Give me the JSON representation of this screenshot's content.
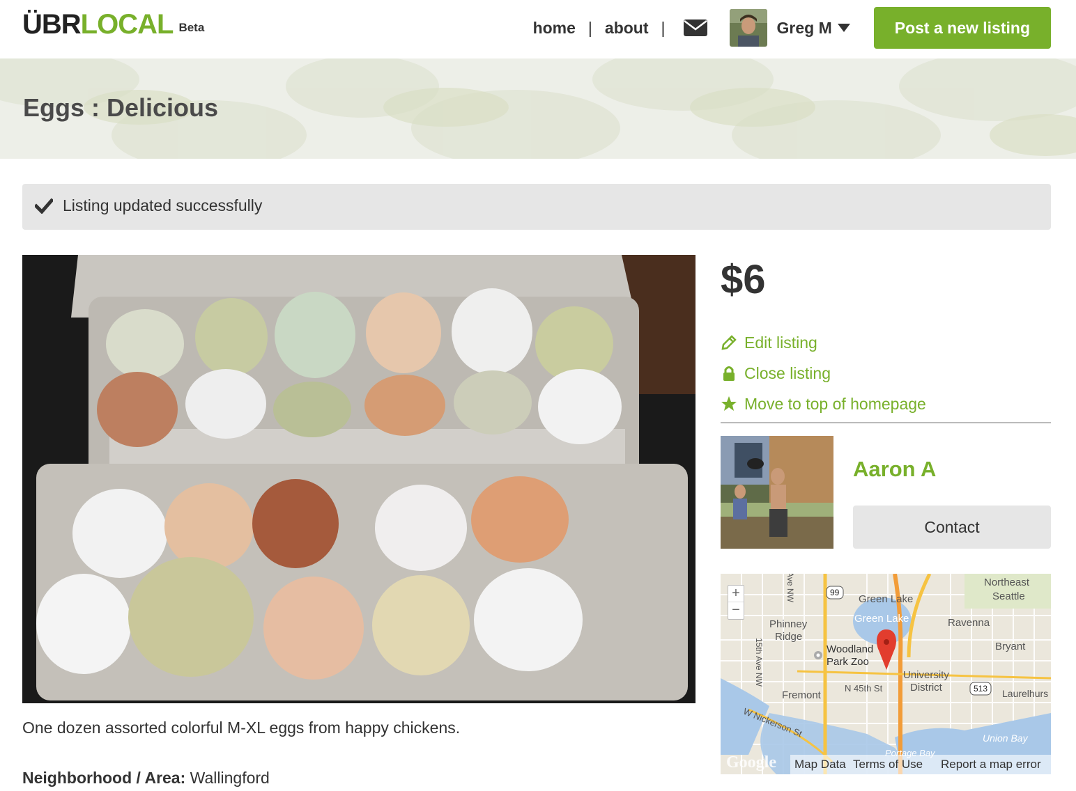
{
  "header": {
    "logo_part1": "ÜBR",
    "logo_part2": "LOCAL",
    "logo_badge": "Beta",
    "nav_home": "home",
    "nav_sep": "|",
    "nav_about": "about",
    "user_name": "Greg M",
    "post_button": "Post a new listing"
  },
  "page": {
    "title": "Eggs : Delicious"
  },
  "flash": {
    "message": "Listing updated successfully"
  },
  "listing": {
    "price": "$6",
    "description": "One dozen assorted colorful M-XL eggs from happy chickens.",
    "neighborhood_label": "Neighborhood / Area:",
    "neighborhood_value": "Wallingford"
  },
  "actions": {
    "edit": "Edit listing",
    "close": "Close listing",
    "move_top": "Move to top of homepage"
  },
  "seller": {
    "name": "Aaron A",
    "contact_button": "Contact"
  },
  "map": {
    "labels": {
      "northeast_seattle_1": "Northeast",
      "northeast_seattle_2": "Seattle",
      "green_lake_1": "Green Lake",
      "green_lake_2": "Green Lake",
      "phinney_1": "Phinney",
      "phinney_2": "Ridge",
      "ravenna": "Ravenna",
      "bryant": "Bryant",
      "woodland_1": "Woodland",
      "woodland_2": "Park Zoo",
      "university_1": "University",
      "university_2": "District",
      "n45th": "N 45th St",
      "fremont": "Fremont",
      "laurelhurst": "Laurelhurs",
      "nickerson": "W Nickerson St",
      "union_bay": "Union Bay",
      "portage": "Portage Bay",
      "ave15": "15th Ave NW",
      "ave_nw": "Ave NW",
      "hwy99": "99",
      "hwy513": "513"
    },
    "zoom_in": "+",
    "zoom_out": "−",
    "google": "Google",
    "map_data": "Map Data",
    "terms": "Terms of Use",
    "report": "Report a map error"
  }
}
